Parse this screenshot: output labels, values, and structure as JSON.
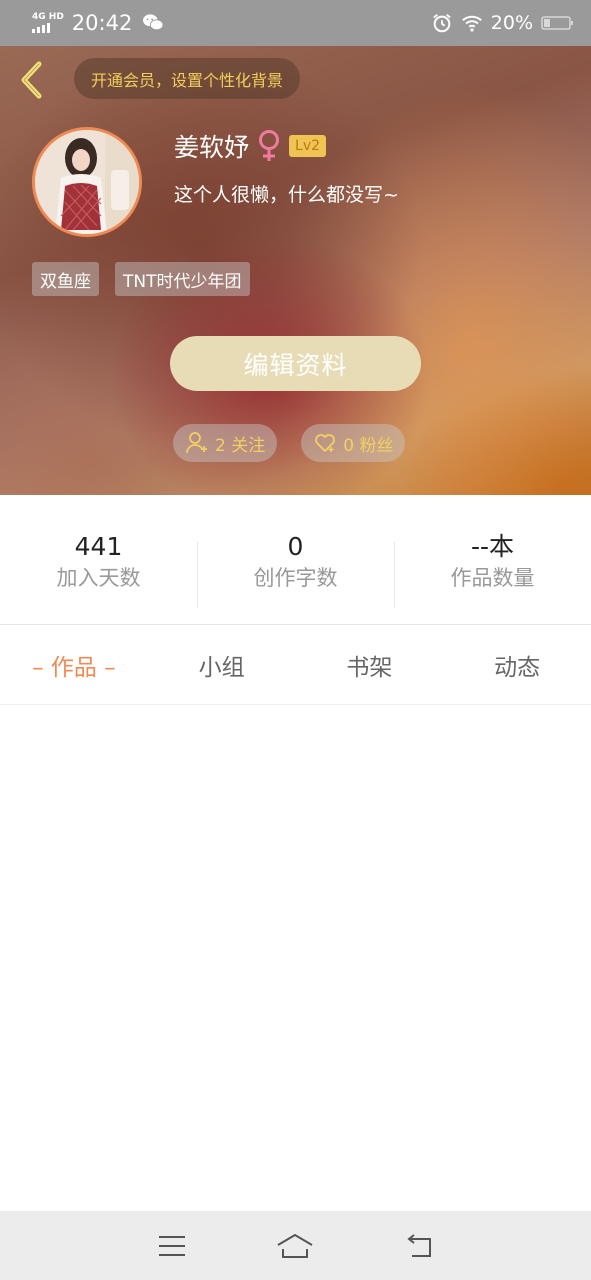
{
  "status_bar": {
    "network_type": "4G HD",
    "time": "20:42",
    "battery": "20%"
  },
  "header": {
    "vip_banner": "开通会员，设置个性化背景"
  },
  "profile": {
    "username": "姜软妤",
    "gender_icon": "female-icon",
    "level": "Lv2",
    "bio": "这个人很懒，什么都没写~",
    "tags": [
      "双鱼座",
      "TNT时代少年团"
    ],
    "edit_button": "编辑资料",
    "following": "2 关注",
    "fans": "0 粉丝"
  },
  "stats": [
    {
      "value": "441",
      "label": "加入天数"
    },
    {
      "value": "0",
      "label": "创作字数"
    },
    {
      "value": "--本",
      "label": "作品数量"
    }
  ],
  "tabs": [
    {
      "label": "– 作品 –",
      "active": true
    },
    {
      "label": "小组",
      "active": false
    },
    {
      "label": "书架",
      "active": false
    },
    {
      "label": "动态",
      "active": false
    }
  ],
  "colors": {
    "accent": "#f08a55",
    "gold": "#f3d061",
    "edit_button_bg": "#e8dcb7",
    "status_bar_bg": "#9a9a9a"
  },
  "nav_icons": [
    "menu-icon",
    "home-icon",
    "back-icon"
  ]
}
